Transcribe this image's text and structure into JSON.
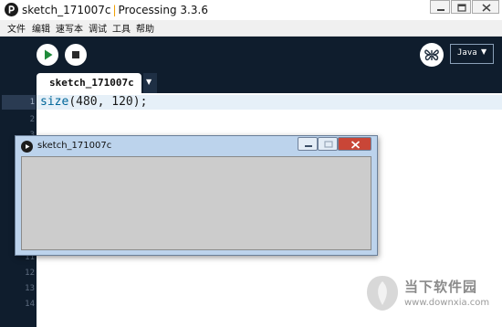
{
  "window": {
    "sketch_name": "sketch_171007c",
    "separator": "|",
    "app_version": "Processing 3.3.6"
  },
  "menu": [
    "文件",
    "编辑",
    "速写本",
    "调试",
    "工具",
    "帮助"
  ],
  "toolbar": {
    "run_icon": "play-icon",
    "stop_icon": "stop-icon",
    "debug_icon": "butterfly-icon",
    "mode": "Java",
    "mode_caret": "▼"
  },
  "tabs": [
    {
      "label": "sketch_171007c",
      "active": true
    }
  ],
  "tab_menu_caret": "▼",
  "editor": {
    "line_numbers": [
      "1",
      "2",
      "3",
      "11",
      "12",
      "13",
      "14"
    ],
    "code_fn": "size",
    "code_args": "(480, 120);"
  },
  "sketch_window": {
    "title": "sketch_171007c",
    "canvas_color": "#cccccc"
  },
  "watermark": {
    "name": "当下软件园",
    "url": "www.downxia.com"
  },
  "colors": {
    "toolbar_bg": "#0f1d2d",
    "editor_bg": "#ffffff",
    "keyword": "#006699",
    "close_red": "#c94637"
  }
}
